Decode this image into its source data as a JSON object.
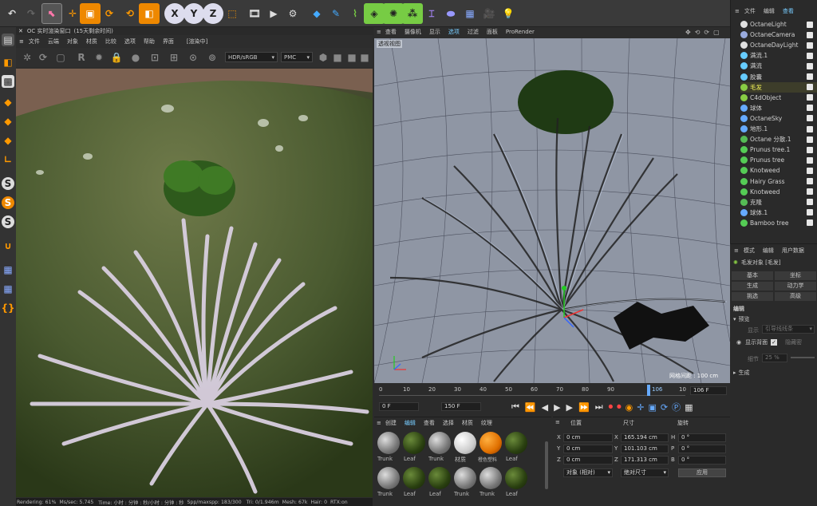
{
  "top_toolbar": {
    "icons": [
      "undo-icon",
      "redo-icon",
      "select-icon",
      "move-icon",
      "scale-icon",
      "rotate-icon",
      "recent-tools-icon",
      "object-icon",
      "x-axis-icon",
      "y-axis-icon",
      "z-axis-icon",
      "world-coord-icon",
      "render-region-icon",
      "render-view-icon",
      "render-settings-icon",
      "cube-icon",
      "pen-icon",
      "spline-icon",
      "subdivision-icon",
      "array-icon",
      "mograph-icon",
      "deformer-icon",
      "field-icon",
      "floor-icon",
      "camera-icon",
      "light-icon"
    ],
    "axis_labels": [
      "X",
      "Y",
      "Z"
    ]
  },
  "octane_window": {
    "title": "OC 实时渲染窗口",
    "trial": "(15天剩余时间)",
    "menu": [
      "文件",
      "云端",
      "对象",
      "材质",
      "比较",
      "选项",
      "帮助",
      "界面"
    ],
    "render_target": "[渲染中]",
    "color_space": "HDR/sRGB",
    "mode": "PMC",
    "status": {
      "rendering": "Rendering: 61%",
      "ms_sec": "Ms/sec: 5.745",
      "time": "Time: 小时 : 分钟 : 秒/小时 : 分钟 : 秒",
      "spp": "Spp/maxspp: 183/300",
      "tri": "Tri: 0/1.946m",
      "mesh": "Mesh: 67k",
      "hair": "Hair: 0",
      "rtx": "RTX:on"
    }
  },
  "viewport": {
    "menu": [
      "查看",
      "摄像机",
      "显示",
      "选项",
      "过滤",
      "面板",
      "ProRender"
    ],
    "label": "透视视图",
    "grid_info": "网格间距 : 100 cm"
  },
  "timeline": {
    "ticks": [
      "0",
      "10",
      "20",
      "30",
      "40",
      "50",
      "60",
      "70",
      "80",
      "90",
      "106",
      "10"
    ],
    "current_frame": "106 F",
    "start": "0 F",
    "end": "150 F",
    "end2": "150 F"
  },
  "object_manager": {
    "menu": [
      "文件",
      "编辑",
      "查看"
    ],
    "items": [
      {
        "name": "OctaneLight",
        "color": "#e0e0e0"
      },
      {
        "name": "OctaneCamera",
        "color": "#9ad"
      },
      {
        "name": "OctaneDayLight",
        "color": "#e0e0e0"
      },
      {
        "name": "满流.1",
        "color": "#6cf"
      },
      {
        "name": "满流",
        "color": "#6cf"
      },
      {
        "name": "胶囊",
        "color": "#6cf"
      },
      {
        "name": "毛发",
        "color": "#8c4"
      },
      {
        "name": "C4dObject",
        "color": "#8c4"
      },
      {
        "name": "球体",
        "color": "#6af"
      },
      {
        "name": "OctaneSky",
        "color": "#6af"
      },
      {
        "name": "地形.1",
        "color": "#6af"
      },
      {
        "name": "Octane 分散.1",
        "color": "#5b5"
      },
      {
        "name": "Prunus tree.1",
        "color": "#5c5"
      },
      {
        "name": "Prunus tree",
        "color": "#5c5"
      },
      {
        "name": "Knotweed",
        "color": "#5c5"
      },
      {
        "name": "Hairy Grass",
        "color": "#5c5"
      },
      {
        "name": "Knotweed",
        "color": "#5c5"
      },
      {
        "name": "克隆",
        "color": "#5b5"
      },
      {
        "name": "球体.1",
        "color": "#6af"
      },
      {
        "name": "Bamboo tree",
        "color": "#5c5"
      }
    ]
  },
  "attributes": {
    "menu": [
      "模式",
      "编辑",
      "用户数据"
    ],
    "object": "毛发对象 [毛发]",
    "tabs": [
      "基本",
      "坐标",
      "生成",
      "动力学",
      "挑选",
      "高级"
    ],
    "section_title": "编辑",
    "preview": "预览",
    "display_label": "显示",
    "display_value": "引导线线条",
    "show_back": "显示背面",
    "show_back2": "隐藏密",
    "detail_label": "细节",
    "detail_value": "25 %",
    "generate": "生成"
  },
  "material_manager": {
    "menu": [
      "创建",
      "编辑",
      "查看",
      "选择",
      "材质",
      "纹理"
    ],
    "row1": [
      "Trunk",
      "Leaf",
      "Trunk",
      "材质",
      "橙色塑料",
      "Leaf"
    ],
    "row2": [
      "Trunk",
      "Leaf",
      "Leaf",
      "Trunk",
      "Trunk",
      "Leaf"
    ]
  },
  "coordinates": {
    "headers": [
      "位置",
      "尺寸",
      "旋转"
    ],
    "x_pos": "0 cm",
    "y_pos": "0 cm",
    "z_pos": "0 cm",
    "x_size": "165.194 cm",
    "y_size": "101.103 cm",
    "z_size": "171.313 cm",
    "h": "0 °",
    "p": "0 °",
    "b": "0 °",
    "mode": "对象 (相对)",
    "size_mode": "绝对尺寸",
    "apply": "应用"
  }
}
